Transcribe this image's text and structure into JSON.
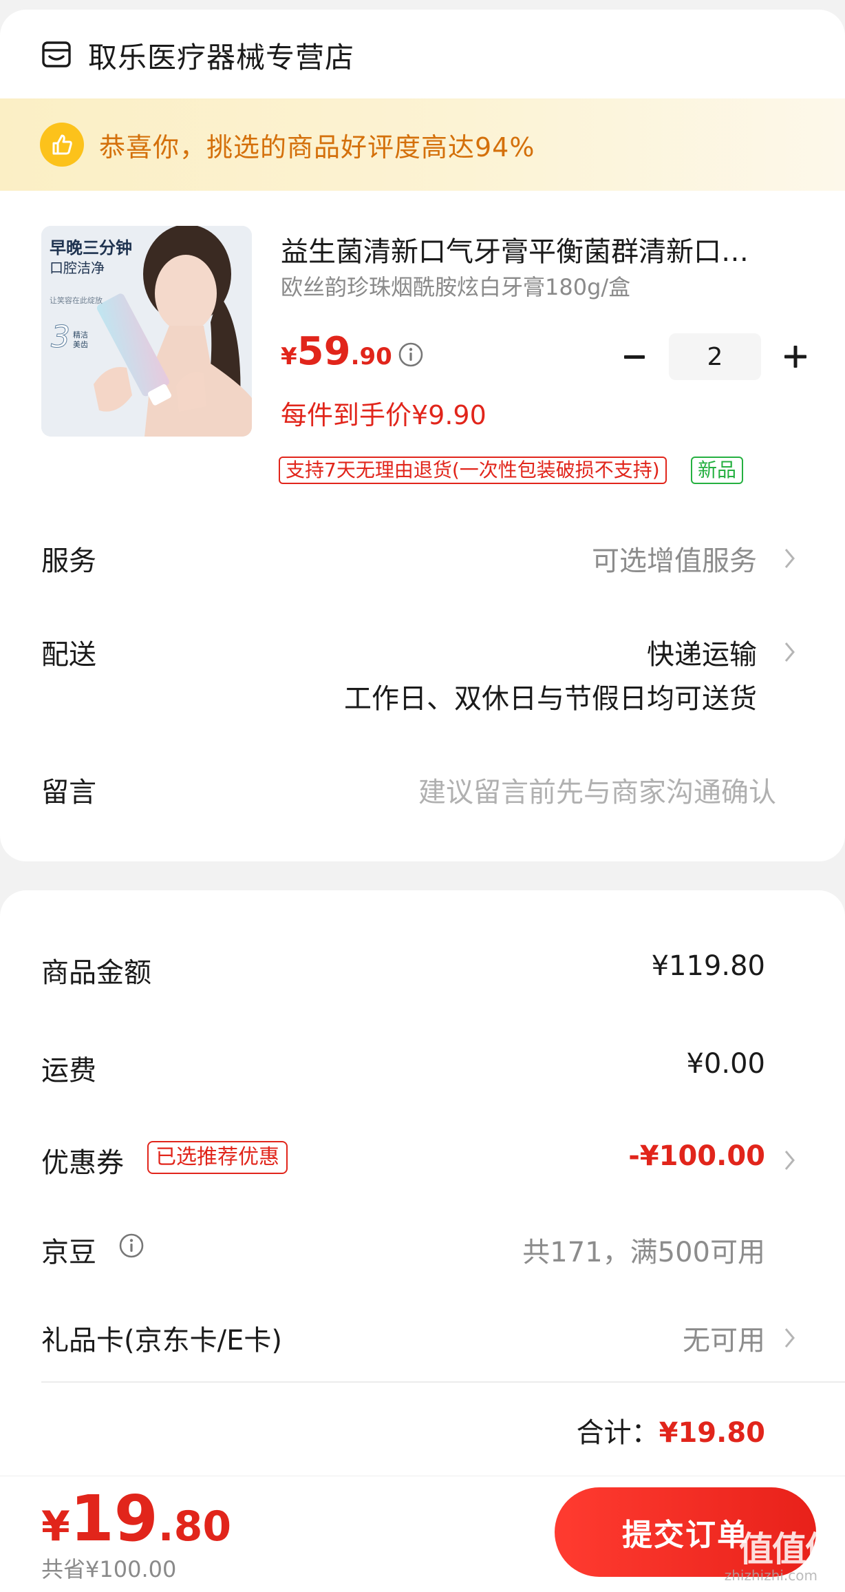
{
  "store": {
    "name": "取乐医疗器械专营店",
    "icon": "store-icon"
  },
  "banner": {
    "text": "恭喜你，挑选的商品好评度高达94%",
    "icon": "thumbs-up-icon"
  },
  "product": {
    "title": "益生菌清新口气牙膏平衡菌群清新口…",
    "spec": "欧丝韵珍珠烟酰胺炫白牙膏180g/盒",
    "price_currency": "¥",
    "price_int": "59",
    "price_dec": ".90",
    "final_price": "每件到手价¥9.90",
    "quantity": "2",
    "tag_return": "支持7天无理由退货(一次性包装破损不支持)",
    "tag_new": "新品",
    "image_text": {
      "line1": "早晚三分钟",
      "line2": "口腔洁净",
      "line3": "让笑容在此绽放",
      "num": "3",
      "badge1": "精洁",
      "badge2": "美齿"
    }
  },
  "rows": {
    "service_label": "服务",
    "service_value": "可选增值服务",
    "delivery_label": "配送",
    "delivery_value": "快递运输",
    "delivery_sub": "工作日、双休日与节假日均可送货",
    "message_label": "留言",
    "message_placeholder": "建议留言前先与商家沟通确认"
  },
  "summary": {
    "goods_label": "商品金额",
    "goods_value": "¥119.80",
    "shipping_label": "运费",
    "shipping_value": "¥0.00",
    "coupon_label": "优惠券",
    "coupon_tag": "已选推荐优惠",
    "coupon_value": "-¥100.00",
    "beans_label": "京豆",
    "beans_value": "共171，满500可用",
    "giftcard_label": "礼品卡(京东卡/E卡)",
    "giftcard_value": "无可用",
    "total_label": "合计：",
    "total_value": "¥19.80"
  },
  "bottom": {
    "price_currency": "¥",
    "price_int": "19",
    "price_dec": ".80",
    "saved": "共省¥100.00",
    "submit_label": "提交订单",
    "watermark": "值值值",
    "watermark_sub": "zhizhizhi.com"
  },
  "colors": {
    "accent": "#e1251b",
    "banner_text": "#d4700b",
    "new_tag": "#25b040"
  }
}
